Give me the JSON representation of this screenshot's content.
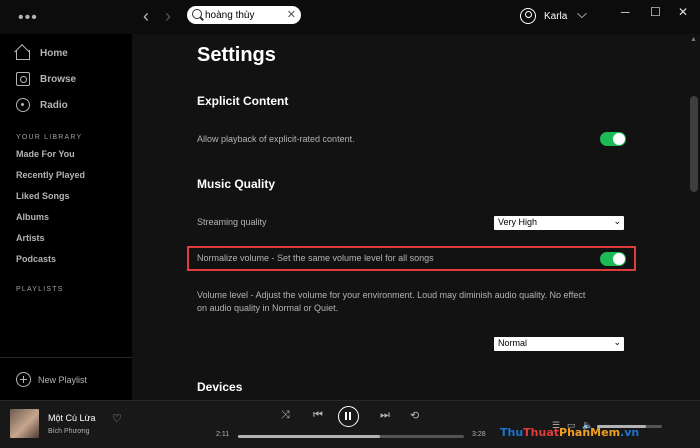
{
  "topbar": {
    "menu_dots": "•••",
    "search_value": "hoàng thùy",
    "user_name": "Karla"
  },
  "sidebar": {
    "nav": [
      {
        "label": "Home",
        "icon": "home-icon"
      },
      {
        "label": "Browse",
        "icon": "browse-icon"
      },
      {
        "label": "Radio",
        "icon": "radio-icon"
      }
    ],
    "library_heading": "YOUR LIBRARY",
    "library_items": [
      "Made For You",
      "Recently Played",
      "Liked Songs",
      "Albums",
      "Artists",
      "Podcasts"
    ],
    "playlists_heading": "PLAYLISTS",
    "new_playlist_label": "New Playlist"
  },
  "settings": {
    "title": "Settings",
    "explicit": {
      "heading": "Explicit Content",
      "label": "Allow playback of explicit-rated content.",
      "enabled": true
    },
    "quality": {
      "heading": "Music Quality",
      "streaming_label": "Streaming quality",
      "streaming_value": "Very High",
      "normalize_label": "Normalize volume - Set the same volume level for all songs",
      "normalize_enabled": true,
      "volume_level_line1": "Volume level - Adjust the volume for your environment. Loud may diminish audio quality. No effect",
      "volume_level_line2": "on audio quality in Normal or Quiet.",
      "volume_level_value": "Normal"
    },
    "devices_heading": "Devices"
  },
  "player": {
    "track_title": "Một Cú Lừa",
    "track_artist": "Bích Phương",
    "time_elapsed": "2:11",
    "time_total": "3:28",
    "progress_fraction": 0.63,
    "volume_fraction": 0.75
  },
  "watermark": {
    "part1": "Thu",
    "part2": "Thuat",
    "part3": "PhanMem",
    "part4": ".vn"
  },
  "colors": {
    "accent_green": "#1db954",
    "highlight_red": "#e03c3c",
    "background": "#121212",
    "sidebar": "#000000"
  }
}
